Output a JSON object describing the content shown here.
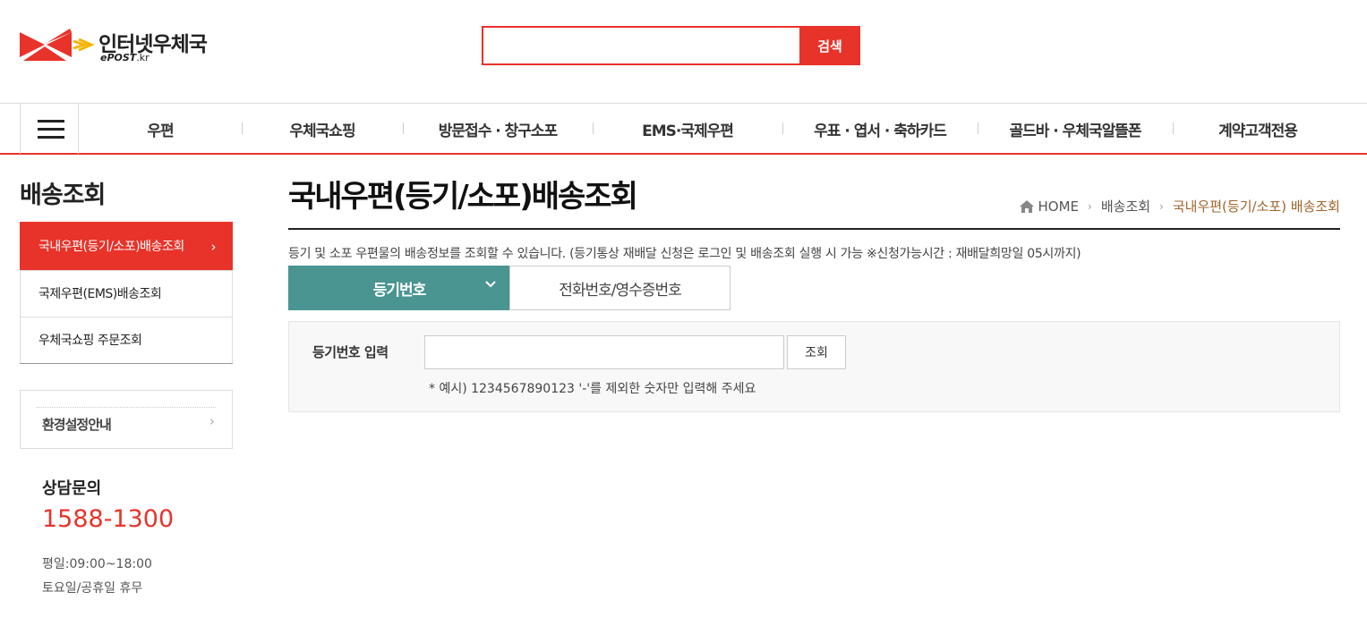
{
  "header": {
    "logo_text": "인터넷우체국",
    "logo_sub": "ePOST",
    "logo_domain": ".kr",
    "search_placeholder": "",
    "search_button": "검색"
  },
  "gnb": {
    "items": [
      {
        "label": "우편"
      },
      {
        "label": "우체국쇼핑"
      },
      {
        "label": "방문접수 · 창구소포"
      },
      {
        "label": "EMS·국제우편"
      },
      {
        "label": "우표 · 엽서 · 축하카드"
      },
      {
        "label": "골드바 · 우체국알뜰폰"
      },
      {
        "label": "계약고객전용"
      }
    ]
  },
  "sidebar": {
    "title": "배송조회",
    "items": [
      {
        "label": "국내우편(등기/소포)배송조회",
        "arrow": "›"
      },
      {
        "label": "국제우편(EMS)배송조회"
      },
      {
        "label": "우체국쇼핑 주문조회"
      }
    ],
    "env_label": "환경설정안내",
    "env_chevron": "›",
    "cs_title": "상담문의",
    "cs_phone": "1588-1300",
    "cs_hours_weekday": "평일:09:00~18:00",
    "cs_hours_weekend": "토요일/공휴일 휴무"
  },
  "main": {
    "title": "국내우편(등기/소포)배송조회",
    "breadcrumb": [
      "HOME",
      "배송조회",
      "국내우편(등기/소포) 배송조회"
    ],
    "breadcrumb_sep": "›",
    "description": "등기 및 소포 우편물의 배송정보를 조회할 수 있습니다. (등기통상 재배달 신청은 로그인 및 배송조회 실행 시 가능 ※신청가능시간 : 재배달희망일 05시까지)",
    "tabs": [
      {
        "label": "등기번호"
      },
      {
        "label": "전화번호/영수증번호"
      }
    ],
    "input_label": "등기번호 입력",
    "input_value": "",
    "submit_button": "조회",
    "hint": "* 예시) 1234567890123 '-'를 제외한 숫자만 입력해 주세요"
  },
  "colors": {
    "accent": "#e8332a",
    "tab_active": "#4a9592",
    "breadcrumb_current": "#a0642c"
  }
}
